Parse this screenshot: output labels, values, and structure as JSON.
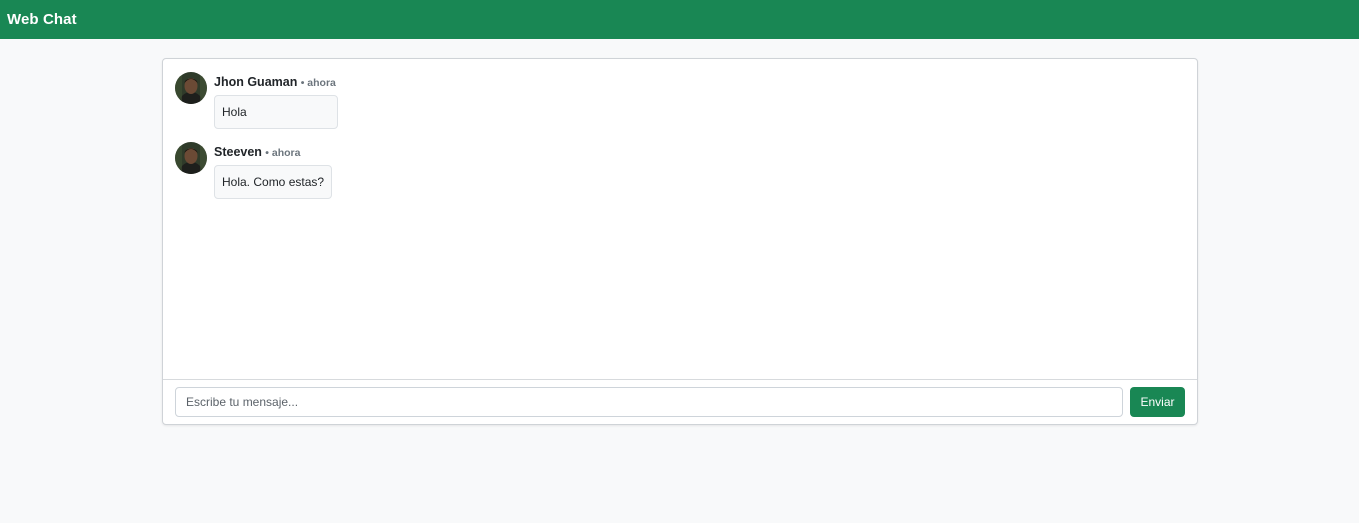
{
  "navbar": {
    "brand": "Web Chat"
  },
  "messages": [
    {
      "author": "Jhon Guaman",
      "time": "• ahora",
      "text": "Hola",
      "avatar_icon": "user-avatar"
    },
    {
      "author": "Steeven",
      "time": "• ahora",
      "text": "Hola. Como estas?",
      "avatar_icon": "user-avatar"
    }
  ],
  "composer": {
    "placeholder": "Escribe tu mensaje...",
    "value": "",
    "send_label": "Enviar"
  },
  "colors": {
    "primary": "#198754",
    "page_background": "#f8f9fa",
    "bubble_background": "#f8f9fa"
  }
}
